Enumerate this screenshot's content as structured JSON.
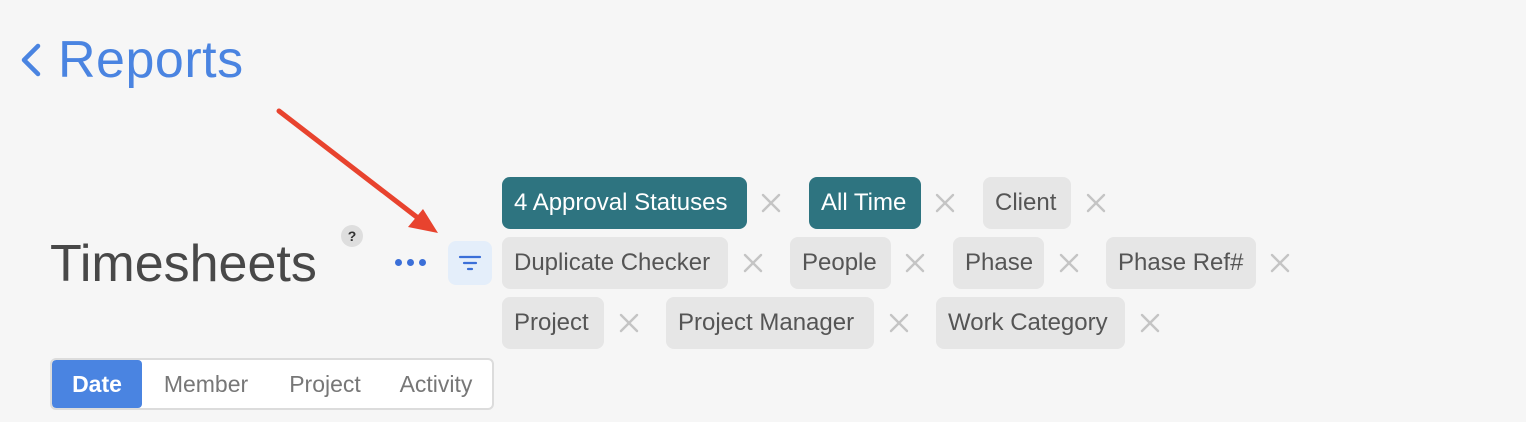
{
  "header": {
    "back_label": "Reports",
    "back_icon": "chevron-left-icon"
  },
  "page": {
    "title": "Timesheets",
    "help_glyph": "?",
    "more_icon": "ellipsis-icon",
    "filter_icon": "filter-icon"
  },
  "filters": [
    {
      "label": "4 Approval Statuses",
      "active": true
    },
    {
      "label": "All Time",
      "active": true
    },
    {
      "label": "Client",
      "active": false
    },
    {
      "label": "Duplicate Checker",
      "active": false
    },
    {
      "label": "People",
      "active": false
    },
    {
      "label": "Phase",
      "active": false
    },
    {
      "label": "Phase Ref#",
      "active": false
    },
    {
      "label": "Project",
      "active": false
    },
    {
      "label": "Project Manager",
      "active": false
    },
    {
      "label": "Work Category",
      "active": false
    }
  ],
  "group_by": {
    "tabs": [
      "Date",
      "Member",
      "Project",
      "Activity"
    ],
    "selected": "Date"
  },
  "colors": {
    "accent": "#4a84e1",
    "active_chip": "#2e7480",
    "chip": "#e6e6e6",
    "annotation_arrow": "#e8432e"
  }
}
